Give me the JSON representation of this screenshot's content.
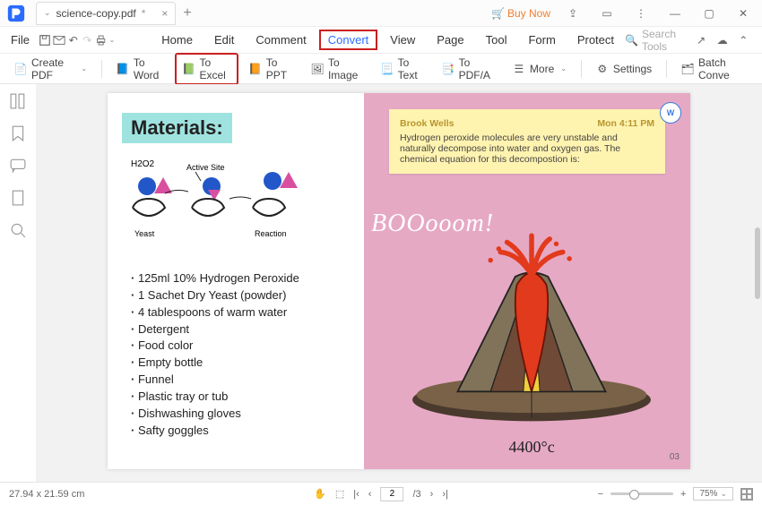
{
  "titlebar": {
    "filename": "science-copy.pdf",
    "modified": "*",
    "buynow": "Buy Now"
  },
  "menubar": {
    "file": "File",
    "tabs": [
      "Home",
      "Edit",
      "Comment",
      "Convert",
      "View",
      "Page",
      "Tool",
      "Form",
      "Protect"
    ],
    "active": "Convert",
    "search_placeholder": "Search Tools"
  },
  "toolbar": {
    "create": "Create PDF",
    "toword": "To Word",
    "toexcel": "To Excel",
    "toppt": "To PPT",
    "toimage": "To Image",
    "totext": "To Text",
    "topdfa": "To PDF/A",
    "more": "More",
    "settings": "Settings",
    "batch": "Batch Conve"
  },
  "document": {
    "materials_title": "Materials:",
    "sketch_labels": {
      "h2o2": "H2O2",
      "active_site": "Active Site",
      "yeast": "Yeast",
      "reaction": "Reaction"
    },
    "materials": [
      "125ml 10% Hydrogen Peroxide",
      "1 Sachet Dry Yeast (powder)",
      "4 tablespoons of warm water",
      "Detergent",
      "Food color",
      "Empty bottle",
      "Funnel",
      "Plastic tray or tub",
      "Dishwashing gloves",
      "Safty goggles"
    ],
    "note": {
      "author": "Brook Wells",
      "time": "Mon 4:11 PM",
      "body": "Hydrogen peroxide molecules are very unstable and naturally decompose into water and oxygen gas. The chemical equation for this decompostion is:"
    },
    "boom": "BOOooom!",
    "temperature": "4400°c",
    "page_number": "03"
  },
  "statusbar": {
    "dimensions": "27.94 x 21.59 cm",
    "page_current": "2",
    "page_total": "/3",
    "zoom": "75%"
  }
}
